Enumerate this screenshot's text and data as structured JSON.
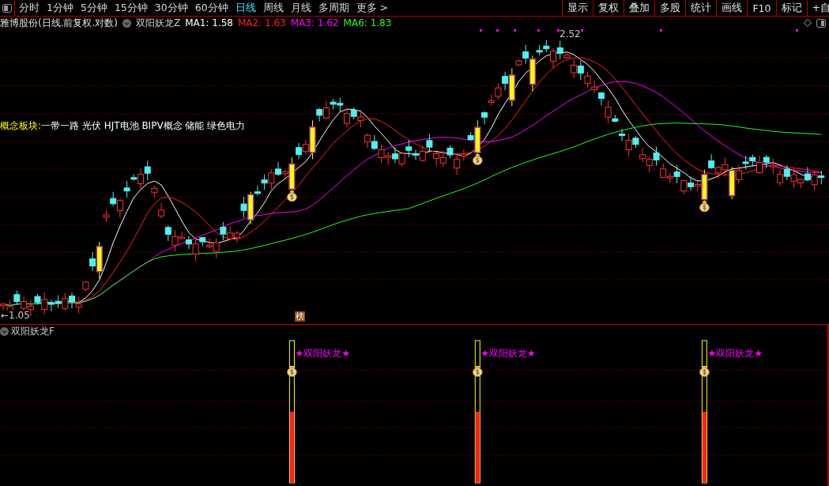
{
  "toolbar": {
    "periods": [
      {
        "label": "分时",
        "selected": false
      },
      {
        "label": "1分钟",
        "selected": false
      },
      {
        "label": "5分钟",
        "selected": false
      },
      {
        "label": "15分钟",
        "selected": false
      },
      {
        "label": "30分钟",
        "selected": false
      },
      {
        "label": "60分钟",
        "selected": false
      },
      {
        "label": "日线",
        "selected": true
      },
      {
        "label": "周线",
        "selected": false
      },
      {
        "label": "月线",
        "selected": false
      },
      {
        "label": "多周期",
        "selected": false
      },
      {
        "label": "更多 >",
        "selected": false
      }
    ],
    "actions": [
      "显示",
      "复权",
      "叠加",
      "多股",
      "统计",
      "画线",
      "F10",
      "标记",
      "+自"
    ]
  },
  "legend": {
    "stock": "雅博股份(日线.前复权.对数)",
    "indicator": "双阳妖龙Z",
    "mas": [
      {
        "label": "MA1: 1.58",
        "color": "#ffffff"
      },
      {
        "label": "MA2: 1.63",
        "color": "#ff2020"
      },
      {
        "label": "MA3: 1.62",
        "color": "#ff00ff"
      },
      {
        "label": "MA6: 1.83",
        "color": "#20ff20"
      }
    ]
  },
  "concept": {
    "label": "概念板块:",
    "text": "一带一路 光伏 HJT电池 BIPV概念 储能 绿色电力"
  },
  "price_high": "2.52",
  "price_low": "←1.05",
  "badge": "榜",
  "lower_panel": {
    "title": "双阳妖龙F",
    "signals": [
      "★双阳妖龙★",
      "★双阳妖龙★",
      "★双阳妖龙★"
    ]
  }
}
